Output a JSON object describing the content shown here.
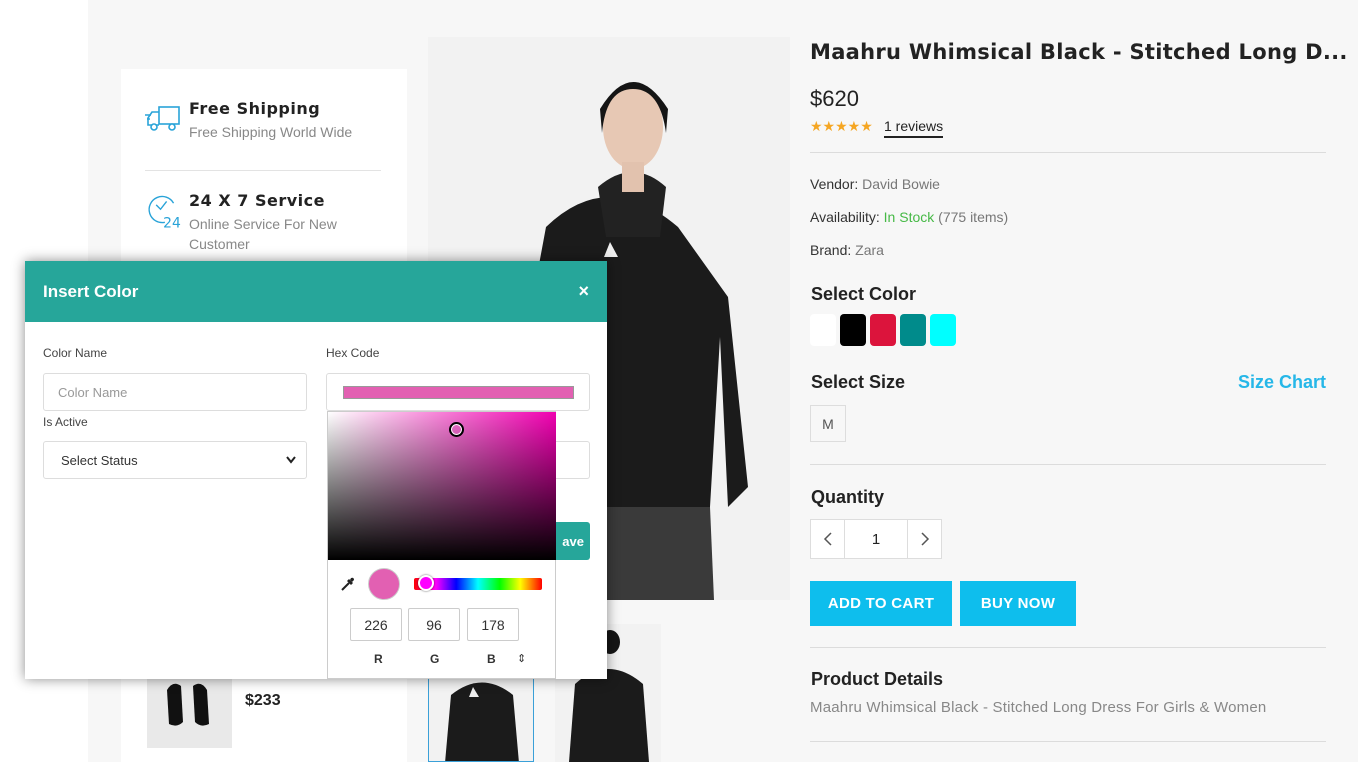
{
  "services": [
    {
      "title": "Free Shipping",
      "subtitle": "Free Shipping World Wide",
      "icon": "truck-icon"
    },
    {
      "title": "24 X 7 Service",
      "subtitle": "Online Service For New Customer",
      "icon": "clock-24-icon"
    }
  ],
  "related": {
    "price": "$233"
  },
  "product": {
    "title": "Maahru Whimsical Black - Stitched Long D...",
    "price": "$620",
    "stars": "★★★★★",
    "reviews": "1 reviews",
    "vendor_label": "Vendor:",
    "vendor": "David Bowie",
    "availability_label": "Availability:",
    "availability": "In Stock",
    "availability_count": "(775 items)",
    "brand_label": "Brand:",
    "brand": "Zara",
    "select_color_label": "Select Color",
    "colors": [
      "#ffffff",
      "#000000",
      "#dc143c",
      "#008b8b",
      "#00ffff"
    ],
    "select_size_label": "Select Size",
    "size_chart_label": "Size Chart",
    "size": "M",
    "quantity_label": "Quantity",
    "quantity": "1",
    "add_to_cart": "ADD TO CART",
    "buy_now": "BUY NOW",
    "details_label": "Product Details",
    "details_text": "Maahru Whimsical Black - Stitched Long Dress For Girls & Women"
  },
  "modal": {
    "title": "Insert Color",
    "close": "×",
    "color_name_label": "Color Name",
    "color_name_placeholder": "Color Name",
    "hex_code_label": "Hex Code",
    "hex_value_color": "#e260b2",
    "is_active_label": "Is Active",
    "status_selected": "Select Status",
    "save_label": "ave",
    "picker": {
      "r": "226",
      "g": "96",
      "b": "178",
      "r_label": "R",
      "g_label": "G",
      "b_label": "B",
      "mode_toggle": "⇕"
    }
  },
  "accent_colors": {
    "teal": "#26a69a",
    "blue": "#0ebeed",
    "green": "#46b946",
    "star": "#f5a623"
  }
}
